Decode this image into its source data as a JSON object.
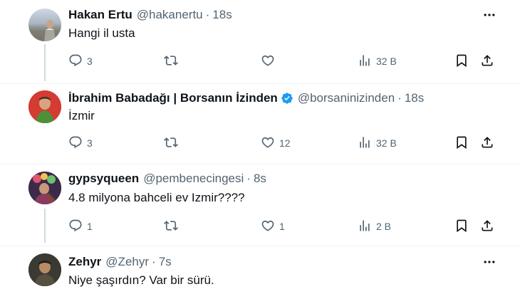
{
  "icons": {
    "reply": "reply-icon",
    "retweet": "retweet-icon",
    "like": "like-icon",
    "views": "views-icon",
    "bookmark": "bookmark-icon",
    "share": "share-icon",
    "more": "more-icon",
    "verified": "verified-badge-icon"
  },
  "colors": {
    "text": "#0f1419",
    "secondary": "#536471",
    "verified": "#1d9bf0",
    "thread_line": "#cfd9de"
  },
  "tweets": [
    {
      "name": "Hakan Ertu",
      "handle": "@hakanertu",
      "separator": "·",
      "time": "18s",
      "text": "Hangi il usta",
      "replies": "3",
      "retweets": "",
      "likes": "",
      "views": "32 B"
    },
    {
      "name": "İbrahim Babadağı | Borsanın İzinden",
      "handle": "@borsaninizinden",
      "separator": "·",
      "time": "18s",
      "text": "İzmir",
      "replies": "3",
      "retweets": "",
      "likes": "12",
      "views": "32 B"
    },
    {
      "name": "gypsyqueen",
      "handle": "@pembenecingesi",
      "separator": "·",
      "time": "8s",
      "text": "4.8 milyona bahceli ev Izmir????",
      "replies": "1",
      "retweets": "",
      "likes": "1",
      "views": "2 B"
    },
    {
      "name": "Zehyr",
      "handle": "@Zehyr",
      "separator": "·",
      "time": "7s",
      "text": "Niye şaşırdın? Var bir sürü."
    }
  ]
}
